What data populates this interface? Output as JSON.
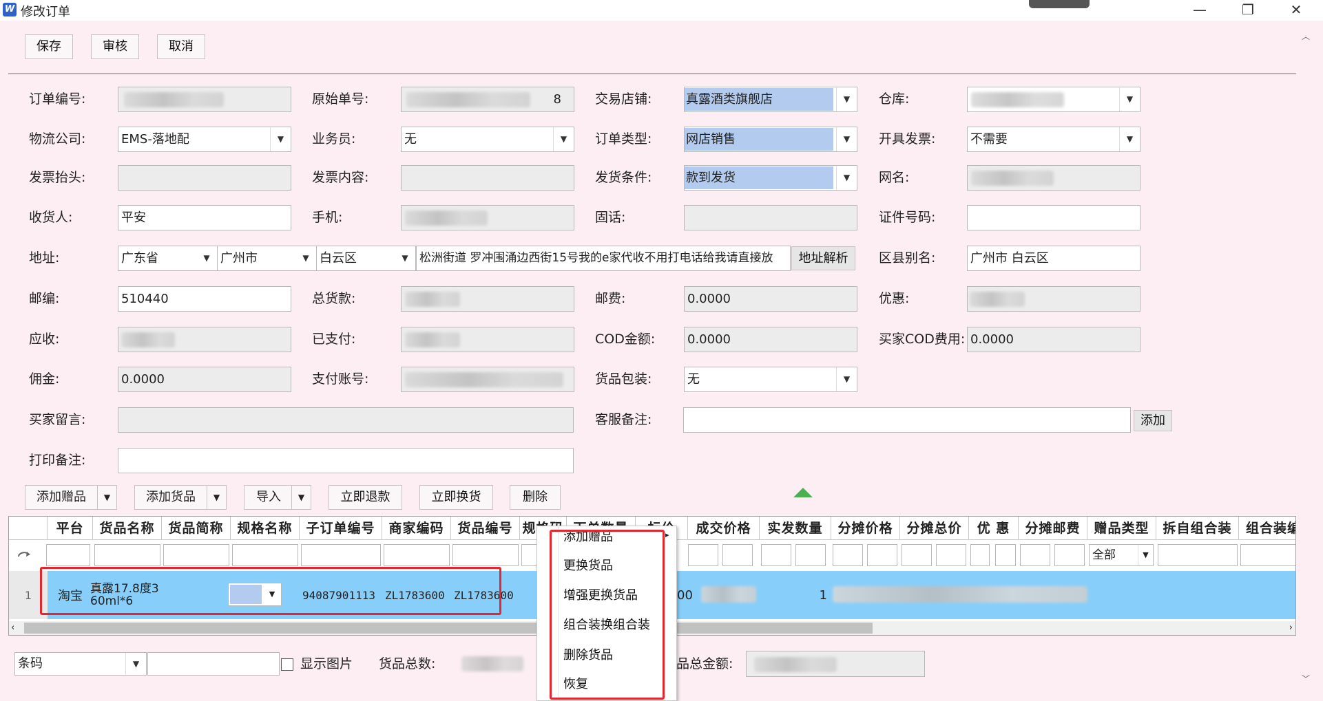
{
  "window": {
    "title": "修改订单",
    "app_icon_letter": "W",
    "min_glyph": "—",
    "max_glyph": "❐",
    "close_glyph": "✕"
  },
  "toolbar": {
    "save": "保存",
    "audit": "审核",
    "cancel": "取消"
  },
  "form": {
    "order_no": {
      "label": "订单编号:",
      "value": ""
    },
    "original_no": {
      "label": "原始单号:",
      "value": "8"
    },
    "shop": {
      "label": "交易店铺:",
      "value": "真露酒类旗舰店"
    },
    "warehouse": {
      "label": "仓库:",
      "value": ""
    },
    "logistics": {
      "label": "物流公司:",
      "value": "EMS-落地配"
    },
    "salesman": {
      "label": "业务员:",
      "value": "无"
    },
    "order_type": {
      "label": "订单类型:",
      "value": "网店销售"
    },
    "invoice": {
      "label": "开具发票:",
      "value": "不需要"
    },
    "invoice_title": {
      "label": "发票抬头:",
      "value": ""
    },
    "invoice_content": {
      "label": "发票内容:",
      "value": ""
    },
    "ship_cond": {
      "label": "发货条件:",
      "value": "款到发货"
    },
    "nickname": {
      "label": "网名:",
      "value": ""
    },
    "receiver": {
      "label": "收货人:",
      "value": "平安"
    },
    "mobile": {
      "label": "手机:",
      "value": ""
    },
    "phone": {
      "label": "固话:",
      "value": ""
    },
    "id_no": {
      "label": "证件号码:",
      "value": ""
    },
    "address": {
      "label": "地址:",
      "province": "广东省",
      "city": "广州市",
      "district": "白云区",
      "detail": "松洲街道 罗冲围涌边西街15号我的e家代收不用打电话给我请直接放",
      "parse_btn": "地址解析"
    },
    "district_alias": {
      "label": "区县别名:",
      "value": "广州市 白云区"
    },
    "postcode": {
      "label": "邮编:",
      "value": "510440"
    },
    "total_goods": {
      "label": "总货款:",
      "value": ""
    },
    "postage": {
      "label": "邮费:",
      "value": "0.0000"
    },
    "discount": {
      "label": "优惠:",
      "value": ""
    },
    "receivable": {
      "label": "应收:",
      "value": ""
    },
    "paid": {
      "label": "已支付:",
      "value": ""
    },
    "cod_amount": {
      "label": "COD金额:",
      "value": "0.0000"
    },
    "buyer_cod_fee": {
      "label": "买家COD费用:",
      "value": "0.0000"
    },
    "commission": {
      "label": "佣金:",
      "value": "0.0000"
    },
    "pay_account": {
      "label": "支付账号:",
      "value": ""
    },
    "packaging": {
      "label": "货品包装:",
      "value": "无"
    },
    "buyer_msg": {
      "label": "买家留言:",
      "value": ""
    },
    "cs_remark": {
      "label": "客服备注:",
      "value": "",
      "add_btn": "添加"
    },
    "print_remark": {
      "label": "打印备注:",
      "value": ""
    }
  },
  "goods_toolbar": {
    "add_gift": "添加赠品",
    "add_goods": "添加货品",
    "import": "导入",
    "refund": "立即退款",
    "exchange": "立即换货",
    "delete": "删除"
  },
  "grid": {
    "headers": [
      "平台",
      "货品名称",
      "货品简称",
      "规格名称",
      "子订单编号",
      "商家编码",
      "货品编号",
      "规格码",
      "下单数量",
      "标价",
      "成交价格",
      "实发数量",
      "分摊价格",
      "分摊总价",
      "优 惠",
      "分摊邮费",
      "赠品类型",
      "拆自组合装",
      "组合装编号"
    ],
    "gift_filter": "全部",
    "row": {
      "index": "1",
      "platform": "淘宝",
      "goods_name": "真露17.8度360ml*6",
      "sub_order_no": "94087901113",
      "merchant_code": "ZL1783600",
      "goods_no": "ZL1783600",
      "price_frag": "00",
      "ship_qty": "1"
    }
  },
  "context_menu": {
    "items": [
      "添加赠品",
      "更换货品",
      "增强更换货品",
      "组合装换组合装",
      "删除货品",
      "恢复"
    ]
  },
  "footer": {
    "search_type": "条码",
    "search_value": "",
    "show_image": "显示图片",
    "goods_total_label": "货品总数:",
    "amount_total_label": "品总金额:"
  }
}
